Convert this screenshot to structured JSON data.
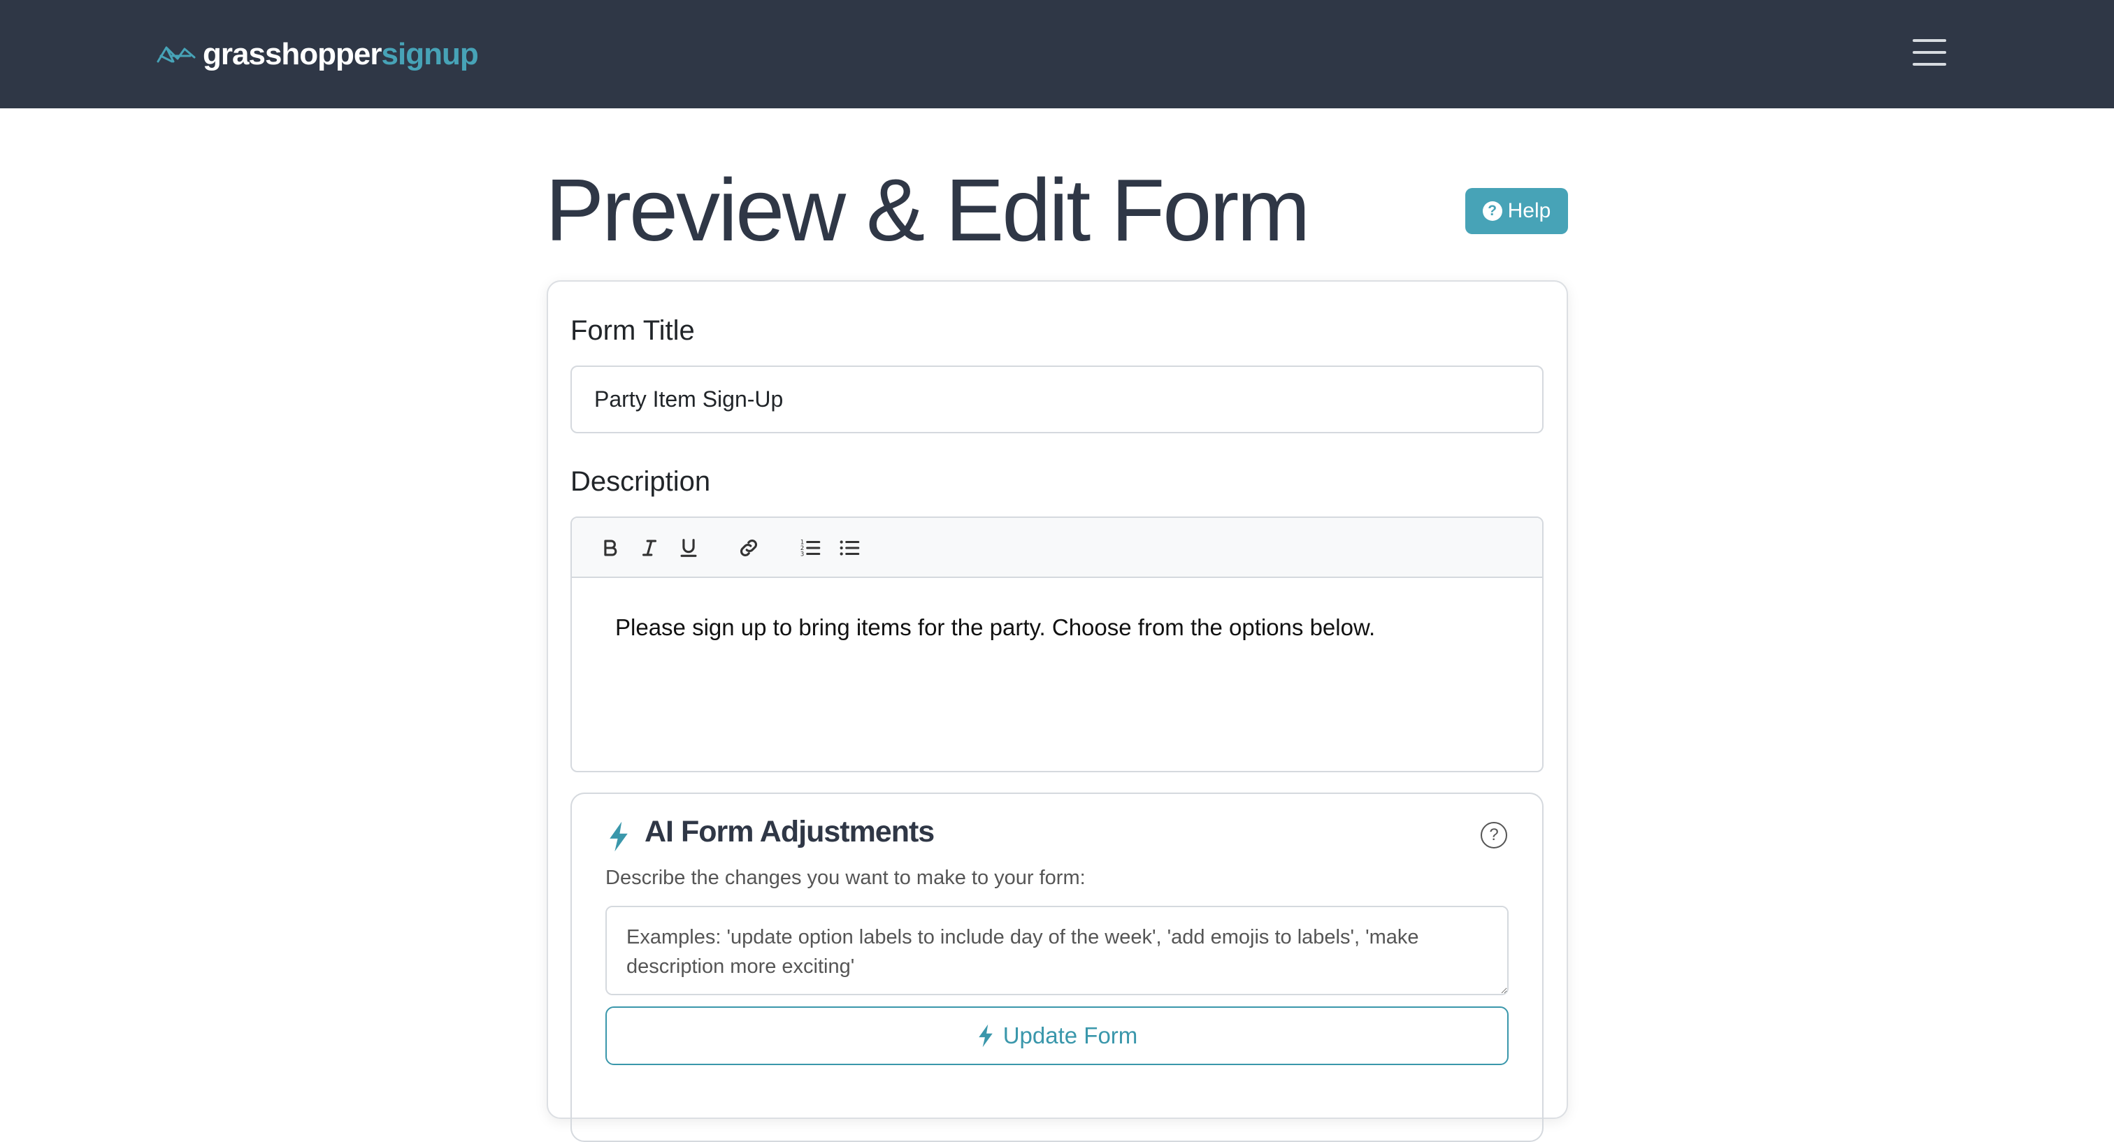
{
  "brand": {
    "part1": "grasshopper",
    "part2": "signup",
    "logo_icon": "grasshopper-logo-icon"
  },
  "nav": {
    "menu_icon": "hamburger-menu-icon"
  },
  "page": {
    "title": "Preview & Edit Form",
    "help_label": "Help",
    "help_icon": "question-circle-icon"
  },
  "form": {
    "title_label": "Form Title",
    "title_value": "Party Item Sign-Up",
    "description_label": "Description",
    "toolbar": [
      "bold-icon",
      "italic-icon",
      "underline-icon",
      "link-icon",
      "ordered-list-icon",
      "bullet-list-icon"
    ],
    "description_text": "Please sign up to bring items for the party. Choose from the options below."
  },
  "ai": {
    "title": "AI Form Adjustments",
    "subtitle": "Describe the changes you want to make to your form:",
    "placeholder": "Examples: 'update option labels to include day of the week', 'add emojis to labels', 'make description more exciting'",
    "button_label": "Update Form",
    "icon": "lightning-bolt-icon",
    "help_icon": "question-circle-icon"
  },
  "colors": {
    "navbar": "#2f3746",
    "accent": "#47a3b7",
    "heading": "#2f3746"
  }
}
